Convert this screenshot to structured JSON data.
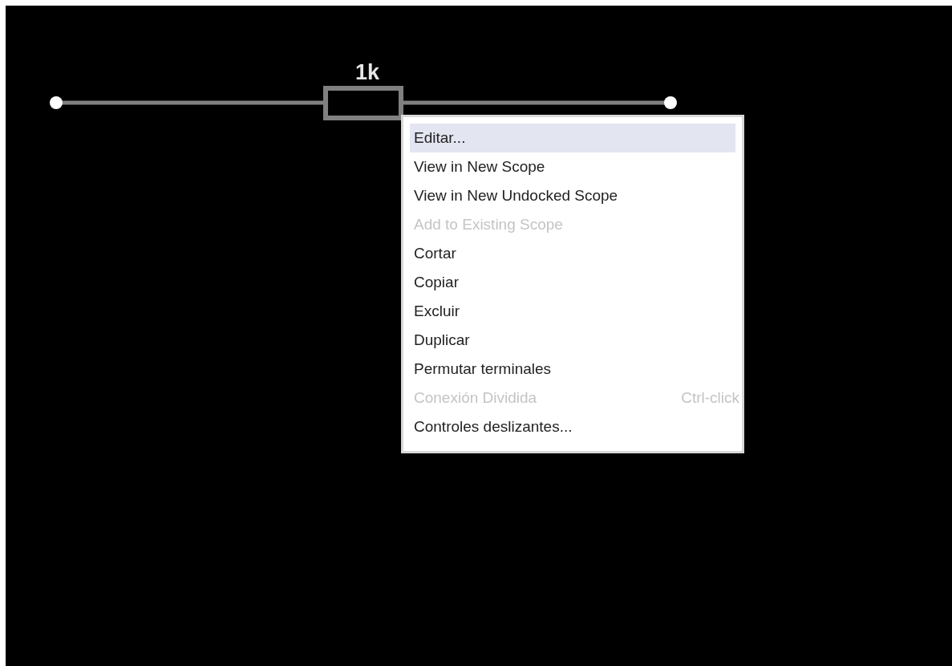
{
  "circuit": {
    "resistor_label": "1k"
  },
  "context_menu": {
    "items": [
      {
        "label": "Editar...",
        "disabled": false,
        "selected": true
      },
      {
        "label": "View in New Scope",
        "disabled": false,
        "selected": false
      },
      {
        "label": "View in New Undocked Scope",
        "disabled": false,
        "selected": false
      },
      {
        "label": "Add to Existing Scope",
        "disabled": true,
        "selected": false
      },
      {
        "label": "Cortar",
        "disabled": false,
        "selected": false
      },
      {
        "label": "Copiar",
        "disabled": false,
        "selected": false
      },
      {
        "label": "Excluir",
        "disabled": false,
        "selected": false
      },
      {
        "label": "Duplicar",
        "disabled": false,
        "selected": false
      },
      {
        "label": "Permutar terminales",
        "disabled": false,
        "selected": false
      },
      {
        "label": "Conexión Dividida",
        "shortcut": "Ctrl-click",
        "disabled": true,
        "selected": false
      },
      {
        "label": "Controles deslizantes...",
        "disabled": false,
        "selected": false
      }
    ]
  }
}
